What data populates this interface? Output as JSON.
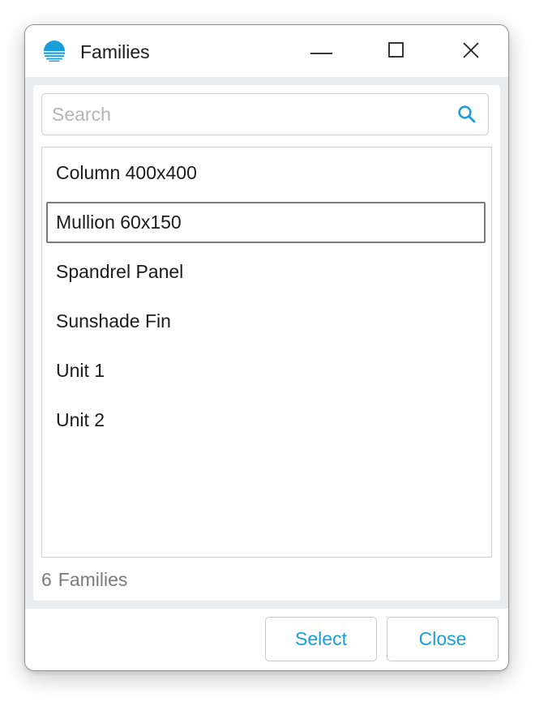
{
  "window": {
    "title": "Families",
    "app_icon": "sun-horizon-icon",
    "controls": [
      "minimize-icon",
      "maximize-icon",
      "close-icon"
    ]
  },
  "search": {
    "placeholder": "Search",
    "value": "",
    "icon": "search-icon"
  },
  "list": {
    "items": [
      {
        "label": "Column 400x400",
        "selected": false
      },
      {
        "label": "Mullion 60x150",
        "selected": true
      },
      {
        "label": "Spandrel Panel",
        "selected": false
      },
      {
        "label": "Sunshade Fin",
        "selected": false
      },
      {
        "label": "Unit 1",
        "selected": false
      },
      {
        "label": "Unit 2",
        "selected": false
      }
    ]
  },
  "status": {
    "count": "6",
    "label": "Families"
  },
  "buttons": {
    "select": "Select",
    "close": "Close"
  },
  "colors": {
    "accent": "#1a9ed9",
    "content_background": "#ebecef",
    "selection_border": "#7a7a7a"
  }
}
